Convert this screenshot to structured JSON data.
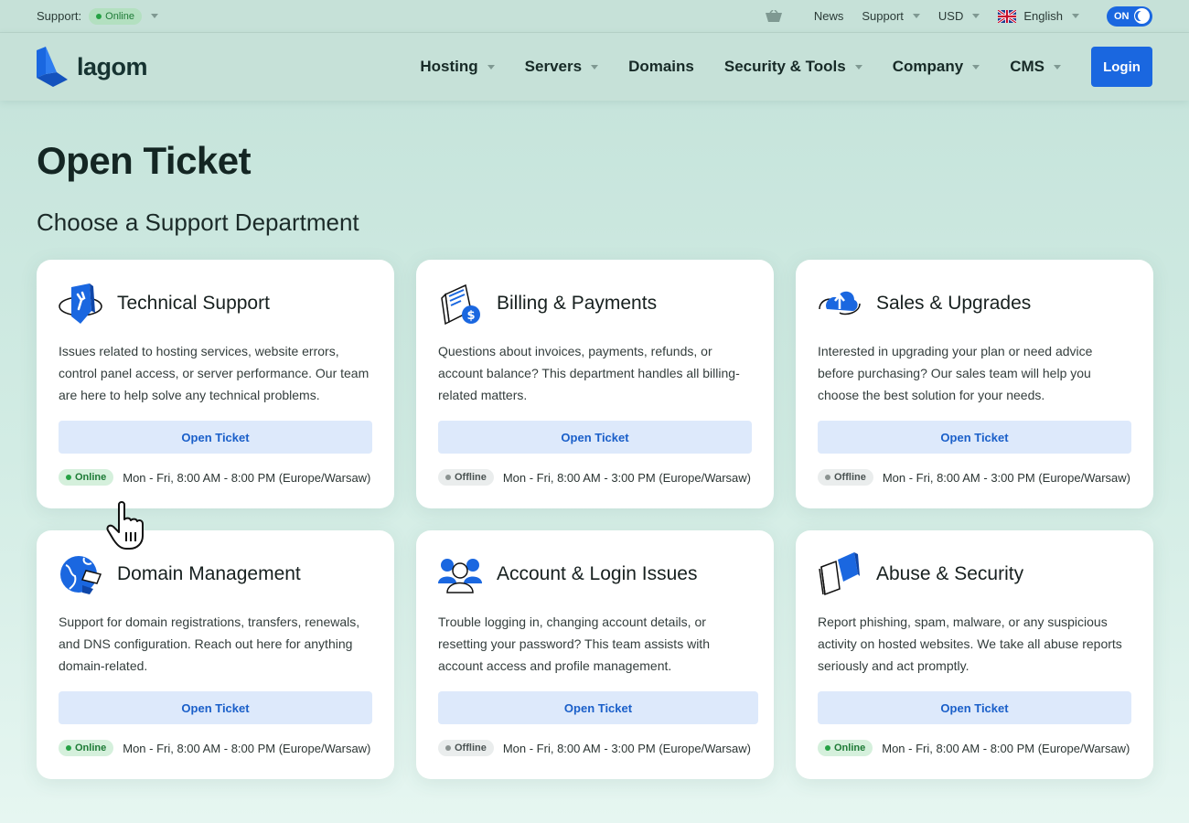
{
  "topbar": {
    "support_label": "Support:",
    "support_status": "Online",
    "news": "News",
    "support": "Support",
    "currency": "USD",
    "language": "English",
    "toggle": "ON"
  },
  "header": {
    "logo": "lagom",
    "nav": [
      "Hosting",
      "Servers",
      "Domains",
      "Security & Tools",
      "Company",
      "CMS"
    ],
    "login": "Login"
  },
  "page": {
    "title": "Open Ticket",
    "subtitle": "Choose a Support Department"
  },
  "departments": [
    {
      "title": "Technical Support",
      "desc": "Issues related to hosting services, website errors, control panel access, or server performance. Our team are here to help solve any technical problems.",
      "button": "Open Ticket",
      "status": "Online",
      "hours": "Mon - Fri,  8:00 AM - 8:00 PM (Europe/Warsaw)",
      "icon": "wrench-shield-icon"
    },
    {
      "title": "Billing & Payments",
      "desc": "Questions about invoices, payments, refunds, or account balance? This department handles all billing-related matters.",
      "button": "Open Ticket",
      "status": "Offline",
      "hours": "Mon - Fri,  8:00 AM - 3:00 PM (Europe/Warsaw)",
      "icon": "invoice-dollar-icon"
    },
    {
      "title": "Sales & Upgrades",
      "desc": "Interested in upgrading your plan or need advice before purchasing? Our sales team will help you choose the best solution for your needs.",
      "button": "Open Ticket",
      "status": "Offline",
      "hours": "Mon - Fri,  8:00 AM - 3:00 PM (Europe/Warsaw)",
      "icon": "cloud-upload-icon"
    },
    {
      "title": "Domain Management",
      "desc": "Support for domain registrations, transfers, renewals, and DNS configuration. Reach out here for anything domain-related.",
      "button": "Open Ticket",
      "status": "Online",
      "hours": "Mon - Fri,  8:00 AM - 8:00 PM (Europe/Warsaw)",
      "icon": "globe-tag-icon"
    },
    {
      "title": "Account & Login Issues",
      "desc": "Trouble logging in, changing account details, or resetting your password? This team assists with account access and profile management.",
      "button": "Open Ticket",
      "status": "Offline",
      "hours": "Mon - Fri,  8:00 AM - 3:00 PM (Europe/Warsaw)",
      "icon": "users-icon"
    },
    {
      "title": "Abuse & Security",
      "desc": "Report phishing, spam, malware, or any suspicious activity on hosted websites. We take all abuse reports seriously and act promptly.",
      "button": "Open Ticket",
      "status": "Online",
      "hours": "Mon - Fri,  8:00 AM - 8:00 PM (Europe/Warsaw)",
      "icon": "shield-book-icon"
    }
  ],
  "colors": {
    "accent": "#1a67e0",
    "online": "#25a244",
    "offline": "#8b9391"
  }
}
